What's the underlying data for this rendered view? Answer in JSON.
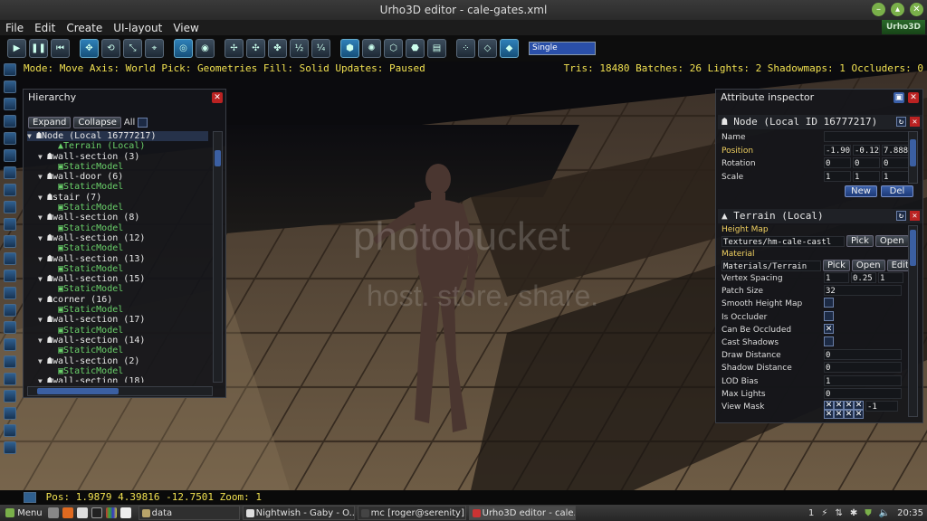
{
  "window": {
    "title": "Urho3D editor - cale-gates.xml"
  },
  "menu": [
    "File",
    "Edit",
    "Create",
    "UI-layout",
    "View"
  ],
  "logo_text": "Urho3D",
  "toolbar": {
    "single_label": "Single",
    "half_label": "½",
    "quarter_label": "¼"
  },
  "status": {
    "left": "Mode: Move   Axis: World   Pick: Geometries   Fill: Solid   Updates: Paused",
    "right": "Tris: 18480   Batches: 26   Lights: 2   Shadowmaps: 1   Occluders: 0"
  },
  "hierarchy": {
    "title": "Hierarchy",
    "expand": "Expand",
    "collapse": "Collapse",
    "all": "All",
    "rows": [
      {
        "indent": 0,
        "arrow": "▼",
        "icon": "☗",
        "text": "Node (Local 16777217)",
        "comp": false,
        "sel": true
      },
      {
        "indent": 2,
        "arrow": "",
        "icon": "▲",
        "text": "Terrain (Local)",
        "comp": true,
        "sel": false
      },
      {
        "indent": 1,
        "arrow": "▼",
        "icon": "☗",
        "text": "wall-section (3)",
        "comp": false,
        "sel": false
      },
      {
        "indent": 2,
        "arrow": "",
        "icon": "▣",
        "text": "StaticModel",
        "comp": true,
        "sel": false
      },
      {
        "indent": 1,
        "arrow": "▼",
        "icon": "☗",
        "text": "wall-door (6)",
        "comp": false,
        "sel": false
      },
      {
        "indent": 2,
        "arrow": "",
        "icon": "▣",
        "text": "StaticModel",
        "comp": true,
        "sel": false
      },
      {
        "indent": 1,
        "arrow": "▼",
        "icon": "☗",
        "text": "stair (7)",
        "comp": false,
        "sel": false
      },
      {
        "indent": 2,
        "arrow": "",
        "icon": "▣",
        "text": "StaticModel",
        "comp": true,
        "sel": false
      },
      {
        "indent": 1,
        "arrow": "▼",
        "icon": "☗",
        "text": "wall-section (8)",
        "comp": false,
        "sel": false
      },
      {
        "indent": 2,
        "arrow": "",
        "icon": "▣",
        "text": "StaticModel",
        "comp": true,
        "sel": false
      },
      {
        "indent": 1,
        "arrow": "▼",
        "icon": "☗",
        "text": "wall-section (12)",
        "comp": false,
        "sel": false
      },
      {
        "indent": 2,
        "arrow": "",
        "icon": "▣",
        "text": "StaticModel",
        "comp": true,
        "sel": false
      },
      {
        "indent": 1,
        "arrow": "▼",
        "icon": "☗",
        "text": "wall-section (13)",
        "comp": false,
        "sel": false
      },
      {
        "indent": 2,
        "arrow": "",
        "icon": "▣",
        "text": "StaticModel",
        "comp": true,
        "sel": false
      },
      {
        "indent": 1,
        "arrow": "▼",
        "icon": "☗",
        "text": "wall-section (15)",
        "comp": false,
        "sel": false
      },
      {
        "indent": 2,
        "arrow": "",
        "icon": "▣",
        "text": "StaticModel",
        "comp": true,
        "sel": false
      },
      {
        "indent": 1,
        "arrow": "▼",
        "icon": "☗",
        "text": "corner (16)",
        "comp": false,
        "sel": false
      },
      {
        "indent": 2,
        "arrow": "",
        "icon": "▣",
        "text": "StaticModel",
        "comp": true,
        "sel": false
      },
      {
        "indent": 1,
        "arrow": "▼",
        "icon": "☗",
        "text": "wall-section (17)",
        "comp": false,
        "sel": false
      },
      {
        "indent": 2,
        "arrow": "",
        "icon": "▣",
        "text": "StaticModel",
        "comp": true,
        "sel": false
      },
      {
        "indent": 1,
        "arrow": "▼",
        "icon": "☗",
        "text": "wall-section (14)",
        "comp": false,
        "sel": false
      },
      {
        "indent": 2,
        "arrow": "",
        "icon": "▣",
        "text": "StaticModel",
        "comp": true,
        "sel": false
      },
      {
        "indent": 1,
        "arrow": "▼",
        "icon": "☗",
        "text": "wall-section (2)",
        "comp": false,
        "sel": false
      },
      {
        "indent": 2,
        "arrow": "",
        "icon": "▣",
        "text": "StaticModel",
        "comp": true,
        "sel": false
      },
      {
        "indent": 1,
        "arrow": "▼",
        "icon": "☗",
        "text": "wall-section (18)",
        "comp": false,
        "sel": false
      }
    ]
  },
  "inspector": {
    "title": "Attribute inspector",
    "node_header": "Node (Local ID 16777217)",
    "node_attrs": [
      {
        "label": "Name",
        "values": [
          ""
        ],
        "modified": false
      },
      {
        "label": "Position",
        "values": [
          "-1.90",
          "-0.12",
          "7.888"
        ],
        "modified": true
      },
      {
        "label": "Rotation",
        "values": [
          "0",
          "0",
          "0"
        ],
        "modified": false
      },
      {
        "label": "Scale",
        "values": [
          "1",
          "1",
          "1"
        ],
        "modified": false
      }
    ],
    "new_btn": "New",
    "del_btn": "Del",
    "terrain_header": "Terrain (Local)",
    "height_map": {
      "label": "Height Map",
      "value": "Textures/hm-cale-castl",
      "pick": "Pick",
      "open": "Open"
    },
    "material": {
      "label": "Material",
      "value": "Materials/Terrain",
      "pick": "Pick",
      "open": "Open",
      "edit": "Edit"
    },
    "terrain_attrs": [
      {
        "label": "Vertex Spacing",
        "type": "vec",
        "values": [
          "1",
          "0.25",
          "1"
        ]
      },
      {
        "label": "Patch Size",
        "type": "num",
        "values": [
          "32"
        ]
      },
      {
        "label": "Smooth Height Map",
        "type": "check",
        "checked": false
      },
      {
        "label": "Is Occluder",
        "type": "check",
        "checked": false
      },
      {
        "label": "Can Be Occluded",
        "type": "check",
        "checked": true
      },
      {
        "label": "Cast Shadows",
        "type": "check",
        "checked": false
      },
      {
        "label": "Draw Distance",
        "type": "num",
        "values": [
          "0"
        ]
      },
      {
        "label": "Shadow Distance",
        "type": "num",
        "values": [
          "0"
        ]
      },
      {
        "label": "LOD Bias",
        "type": "num",
        "values": [
          "1"
        ]
      },
      {
        "label": "Max Lights",
        "type": "num",
        "values": [
          "0"
        ]
      },
      {
        "label": "View Mask",
        "type": "mask",
        "values": [
          "-1"
        ]
      }
    ]
  },
  "bottom_status": "Pos: 1.9879   4.39816   -12.7501  Zoom: 1",
  "watermark": {
    "line1": "photobucket",
    "line2": "host. store. share."
  },
  "taskbar": {
    "menu_label": "Menu",
    "tasks": [
      {
        "label": "data",
        "color": "#b9a46a",
        "active": false
      },
      {
        "label": "Nightwish - Gaby - O...",
        "color": "#dddddd",
        "active": false
      },
      {
        "label": "mc [roger@serenity]...",
        "color": "#444444",
        "active": false
      },
      {
        "label": "Urho3D editor - cale...",
        "color": "#cc3333",
        "active": true
      }
    ],
    "tray_num": "1",
    "clock": "20:35"
  }
}
